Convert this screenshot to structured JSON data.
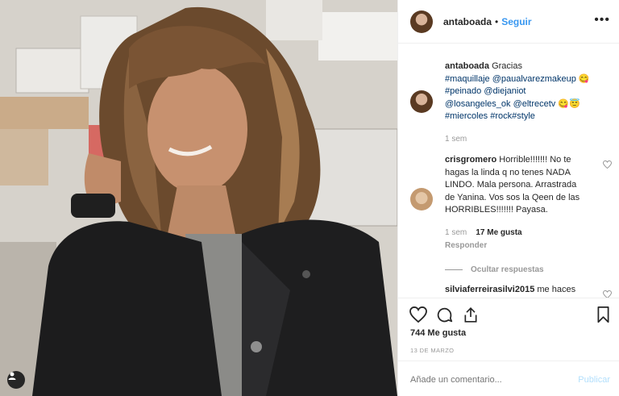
{
  "post": {
    "username": "antaboada",
    "separator": "•",
    "follow_label": "Seguir",
    "more_label": "•••"
  },
  "caption": {
    "username": "antaboada",
    "line1_text": "Gracias",
    "line2_tag1": "#maquillaje",
    "line2_tag2": "@paualvarezmakeup",
    "line2_emoji": "😋",
    "line3_tag1": "#peinado",
    "line3_tag2": "@diejaniot",
    "line4_tag1": "@losangeles_ok",
    "line4_tag2": "@eltrecetv",
    "line4_emoji": "😋😇",
    "line5_tag1": "#miercoles",
    "line5_tag2": "#rock",
    "line5_tag3": "#style",
    "time": "1 sem"
  },
  "comment1": {
    "username": "crisgromero",
    "line1": "Horrible!!!!!!! No te",
    "line2": "hagas la linda q no tenes NADA",
    "line3": "LINDO. Mala persona. Arrastrada",
    "line4": "de Yanina. Vos sos la Qeen de las",
    "line5": "HORRIBLES!!!!!!! Payasa.",
    "time": "1 sem",
    "likes": "17 Me gusta",
    "reply_label": "Responder",
    "hide_replies_label": "Ocultar respuestas"
  },
  "comment2": {
    "username": "silviaferreirasilvi2015",
    "text_start": "me haces"
  },
  "actions": {
    "likes_count": "744 Me gusta",
    "date": "13 DE MARZO"
  },
  "add_comment": {
    "placeholder": "Añade un comentario...",
    "publish_label": "Publicar"
  },
  "colors": {
    "link": "#3897f0",
    "hashtag": "#003569",
    "muted": "#999999",
    "publish_disabled": "#b2dffc"
  },
  "icons": {
    "like": "heart-icon",
    "comment": "comment-icon",
    "share": "share-icon",
    "save": "bookmark-icon",
    "user_tag": "user-icon"
  }
}
